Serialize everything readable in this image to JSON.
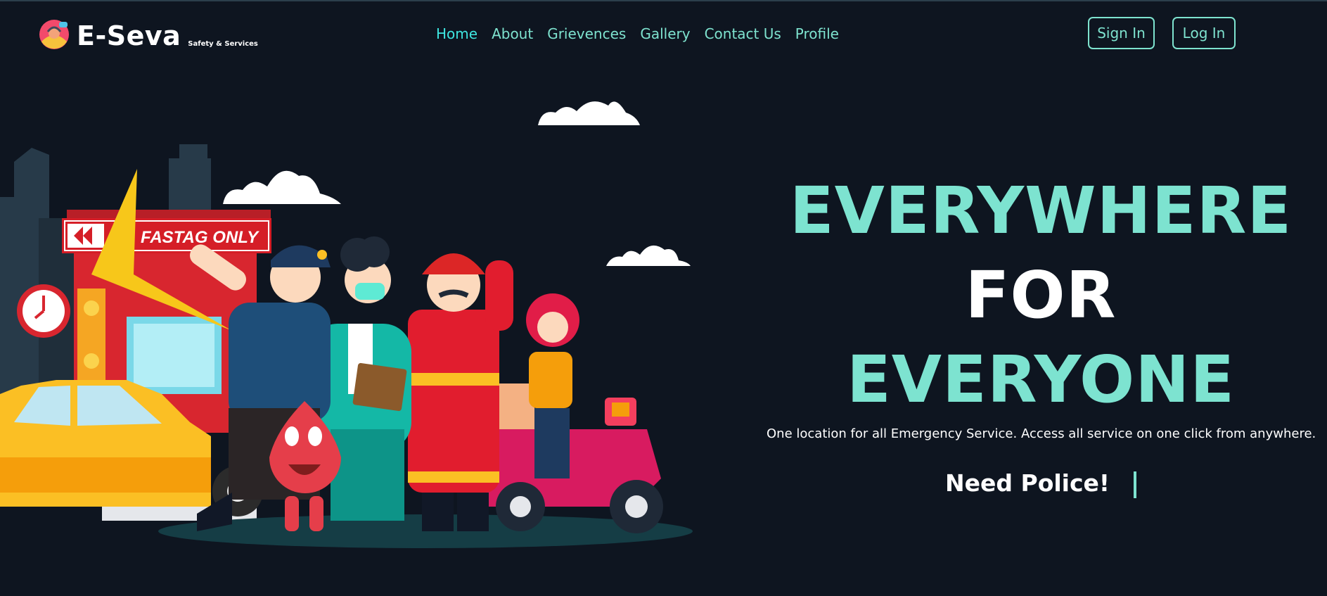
{
  "brand": {
    "name": "E-Seva",
    "tagline": "Safety & Services"
  },
  "nav": {
    "home": "Home",
    "about": "About",
    "grievences": "Grievences",
    "gallery": "Gallery",
    "contact": "Contact Us",
    "profile": "Profile"
  },
  "auth": {
    "sign_in": "Sign In",
    "log_in": "Log In"
  },
  "hero": {
    "line1": "EVERYWHERE",
    "line2_white": "FOR ",
    "line2_teal": "EVERYONE",
    "subtitle": "One location for all Emergency Service. Access all service on one click from anywhere.",
    "typed_text": "Need Police!"
  },
  "illustration": {
    "sign_text": "FASTAG ONLY"
  },
  "colors": {
    "background": "#0e1520",
    "accent": "#7de3d0",
    "nav_active": "#3ee6e0"
  }
}
